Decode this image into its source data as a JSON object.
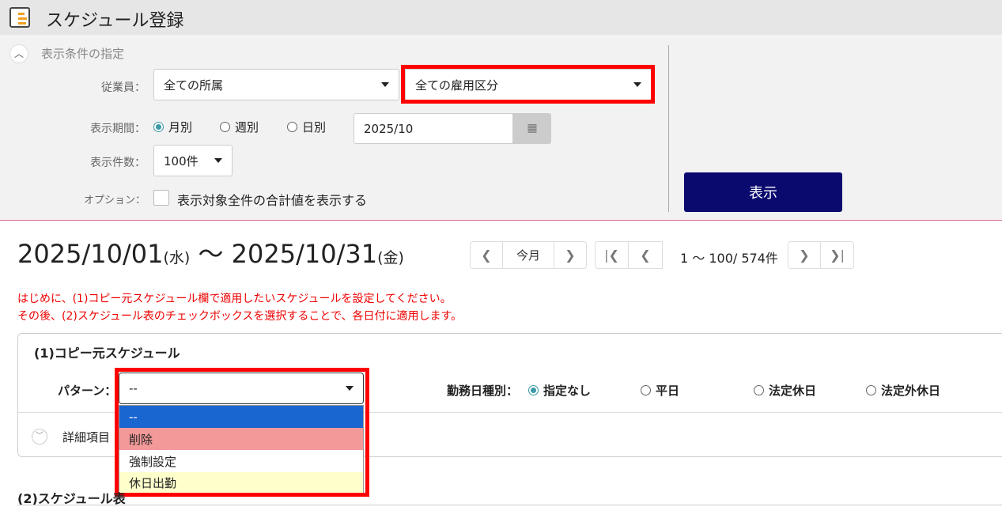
{
  "header": {
    "title": "スケジュール登録",
    "icon": "schedule-icon"
  },
  "filters": {
    "section_title": "表示条件の指定",
    "employee_label": "従業員：",
    "department": "全ての所属",
    "employment_type": "全ての雇用区分",
    "period_label": "表示期間：",
    "period_options": [
      "月別",
      "週別",
      "日別"
    ],
    "period_selected": "月別",
    "date": "2025/10",
    "count_label": "表示件数：",
    "count": "100件",
    "option_label": "オプション：",
    "option_checkbox": "表示対象全件の合計値を表示する",
    "show_button": "表示"
  },
  "range": {
    "start": "2025/10/01",
    "start_dow": "(水)",
    "sep": "〜",
    "end": "2025/10/31",
    "end_dow": "(金)"
  },
  "pager": {
    "this_month": "今月",
    "info": "1 ～ 100/ 574件"
  },
  "instructions": [
    "はじめに、(1)コピー元スケジュール欄で適用したいスケジュールを設定してください。",
    "その後、(2)スケジュール表のチェックボックスを選択することで、各日付に適用します。"
  ],
  "copy_source": {
    "title": "(1)コピー元スケジュール",
    "pattern_label": "パターン：",
    "pattern_value": "--",
    "pattern_options": [
      "--",
      "削除",
      "強制設定",
      "休日出勤"
    ],
    "workday_label": "勤務日種別：",
    "workday_options": [
      "指定なし",
      "平日",
      "法定休日",
      "法定外休日"
    ],
    "workday_selected": "指定なし",
    "details_label": "詳細項目"
  },
  "schedule_table": {
    "title": "(2)スケジュール表"
  },
  "colors": {
    "navy": "#0a0a6e",
    "highlight": "#ff0000",
    "selected": "#1a66d0",
    "delete": "#f39999",
    "holiday": "#ffffcc"
  }
}
